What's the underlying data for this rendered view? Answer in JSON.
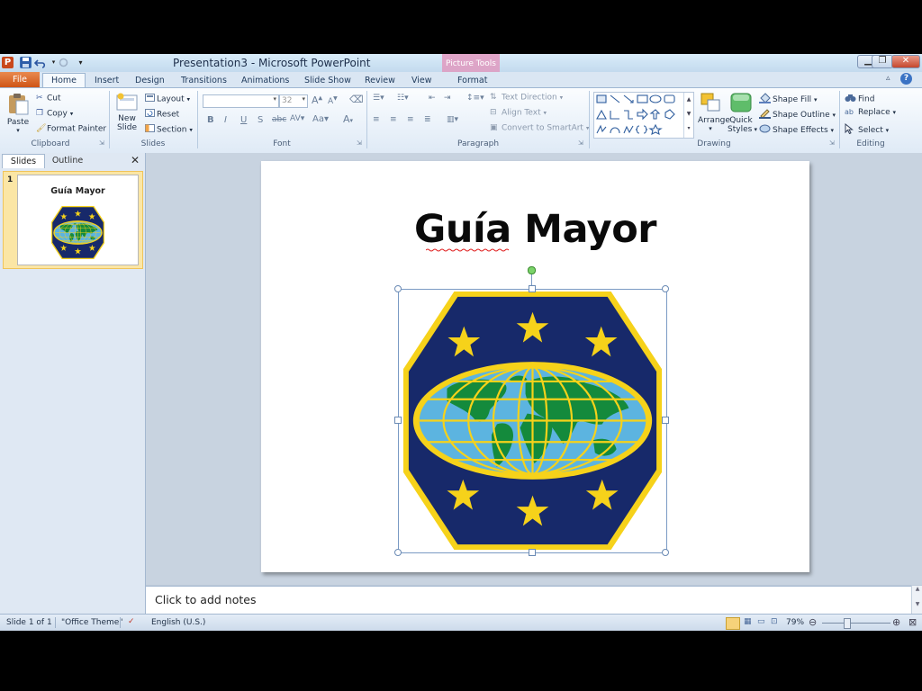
{
  "window": {
    "title": "Presentation3  -  Microsoft PowerPoint",
    "context_tab_group": "Picture Tools",
    "app_icon_letter": "P"
  },
  "tabs": [
    "File",
    "Home",
    "Insert",
    "Design",
    "Transitions",
    "Animations",
    "Slide Show",
    "Review",
    "View",
    "Format"
  ],
  "active_tab": "Home",
  "ribbon": {
    "clipboard": {
      "label": "Clipboard",
      "paste": "Paste",
      "cut": "Cut",
      "copy": "Copy",
      "format_painter": "Format Painter"
    },
    "slides": {
      "label": "Slides",
      "new_slide_1": "New",
      "new_slide_2": "Slide",
      "layout": "Layout",
      "reset": "Reset",
      "section": "Section"
    },
    "font": {
      "label": "Font",
      "size": "32"
    },
    "paragraph": {
      "label": "Paragraph",
      "text_direction": "Text Direction",
      "align_text": "Align Text",
      "convert_smartart": "Convert to SmartArt"
    },
    "drawing": {
      "label": "Drawing",
      "arrange": "Arrange",
      "quick_styles_1": "Quick",
      "quick_styles_2": "Styles",
      "shape_fill": "Shape Fill",
      "shape_outline": "Shape Outline",
      "shape_effects": "Shape Effects"
    },
    "editing": {
      "label": "Editing",
      "find": "Find",
      "replace": "Replace",
      "select": "Select"
    }
  },
  "left_panel": {
    "tab_slides": "Slides",
    "tab_outline": "Outline",
    "slide_number": "1",
    "thumb_title": "Guía Mayor"
  },
  "slide": {
    "title": "Guía Mayor"
  },
  "notes": {
    "placeholder": "Click to add notes"
  },
  "status": {
    "slide_info": "Slide 1 of 1",
    "theme": "\"Office Theme\"",
    "language": "English (U.S.)",
    "zoom": "79%"
  },
  "colors": {
    "emblem_navy": "#17296a",
    "emblem_gold": "#f6d21a",
    "globe_water": "#5cb4e0",
    "globe_land": "#148a3c",
    "file_tab": "#d75b1f"
  }
}
